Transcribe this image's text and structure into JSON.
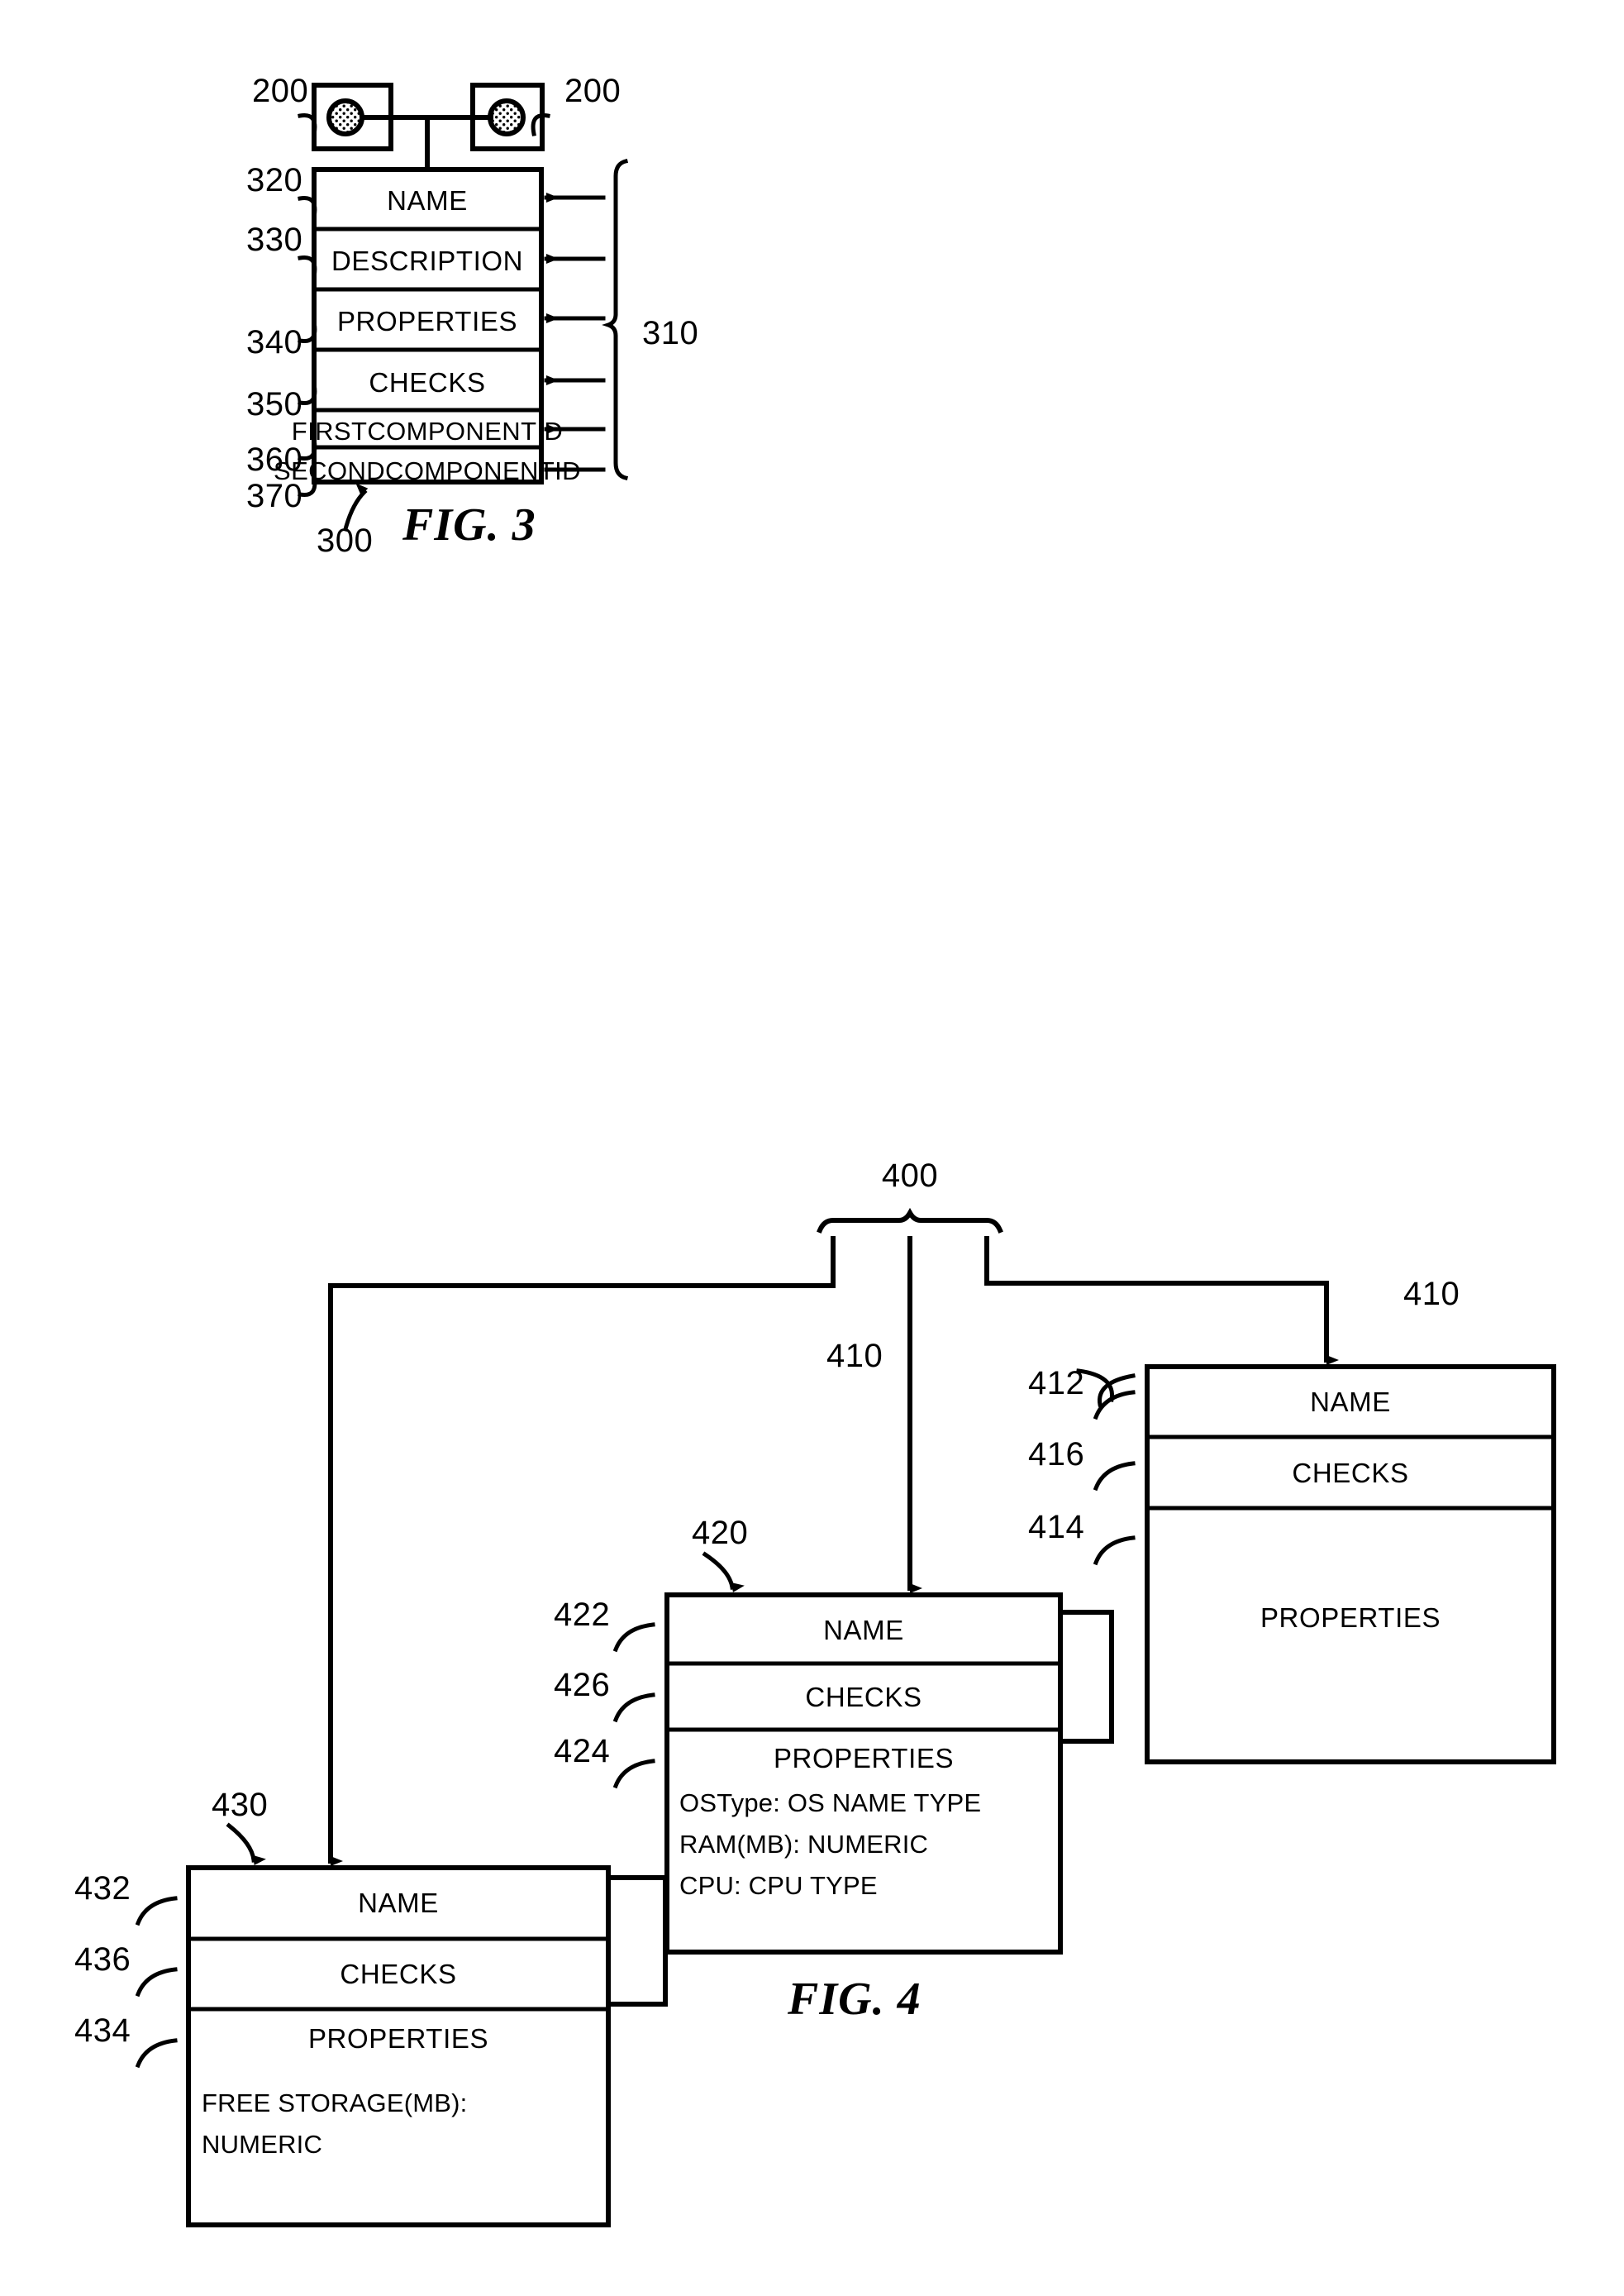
{
  "document": {
    "type": "patent-figure-sheet",
    "figures": [
      "FIG. 3",
      "FIG. 4"
    ]
  },
  "fig3": {
    "caption": "FIG. 3",
    "nodes": [
      {
        "ref": "200",
        "icon": "hatched-circle-node-icon"
      },
      {
        "ref": "200",
        "icon": "hatched-circle-node-icon"
      }
    ],
    "table_ref": "300",
    "bracket_ref": "310",
    "rows": [
      {
        "ref": "320",
        "label": "NAME"
      },
      {
        "ref": "330",
        "label": "DESCRIPTION"
      },
      {
        "ref": "340",
        "label": "PROPERTIES"
      },
      {
        "ref": "350",
        "label": "CHECKS"
      },
      {
        "ref": "360",
        "label": "FIRSTCOMPONENTID"
      },
      {
        "ref": "370",
        "label": "SECONDCOMPONENTID"
      }
    ]
  },
  "fig4": {
    "caption": "FIG. 4",
    "root_ref": "400",
    "boxes": [
      {
        "ref": "410",
        "name": "box-410",
        "rows": [
          {
            "ref": "412",
            "label": "NAME"
          },
          {
            "ref": "416",
            "label": "CHECKS"
          },
          {
            "ref": "414",
            "label": "PROPERTIES",
            "properties": []
          }
        ]
      },
      {
        "ref": "420",
        "name": "box-420",
        "rows": [
          {
            "ref": "422",
            "label": "NAME"
          },
          {
            "ref": "426",
            "label": "CHECKS"
          },
          {
            "ref": "424",
            "label": "PROPERTIES",
            "properties": [
              "OSType: OS NAME TYPE",
              "RAM(MB): NUMERIC",
              "CPU: CPU TYPE"
            ]
          }
        ]
      },
      {
        "ref": "430",
        "name": "box-430",
        "rows": [
          {
            "ref": "432",
            "label": "NAME"
          },
          {
            "ref": "436",
            "label": "CHECKS"
          },
          {
            "ref": "434",
            "label": "PROPERTIES",
            "properties": [
              "FREE STORAGE(MB):",
              "NUMERIC"
            ]
          }
        ]
      }
    ]
  },
  "colors": {
    "ink": "#000000",
    "paper": "#ffffff"
  }
}
